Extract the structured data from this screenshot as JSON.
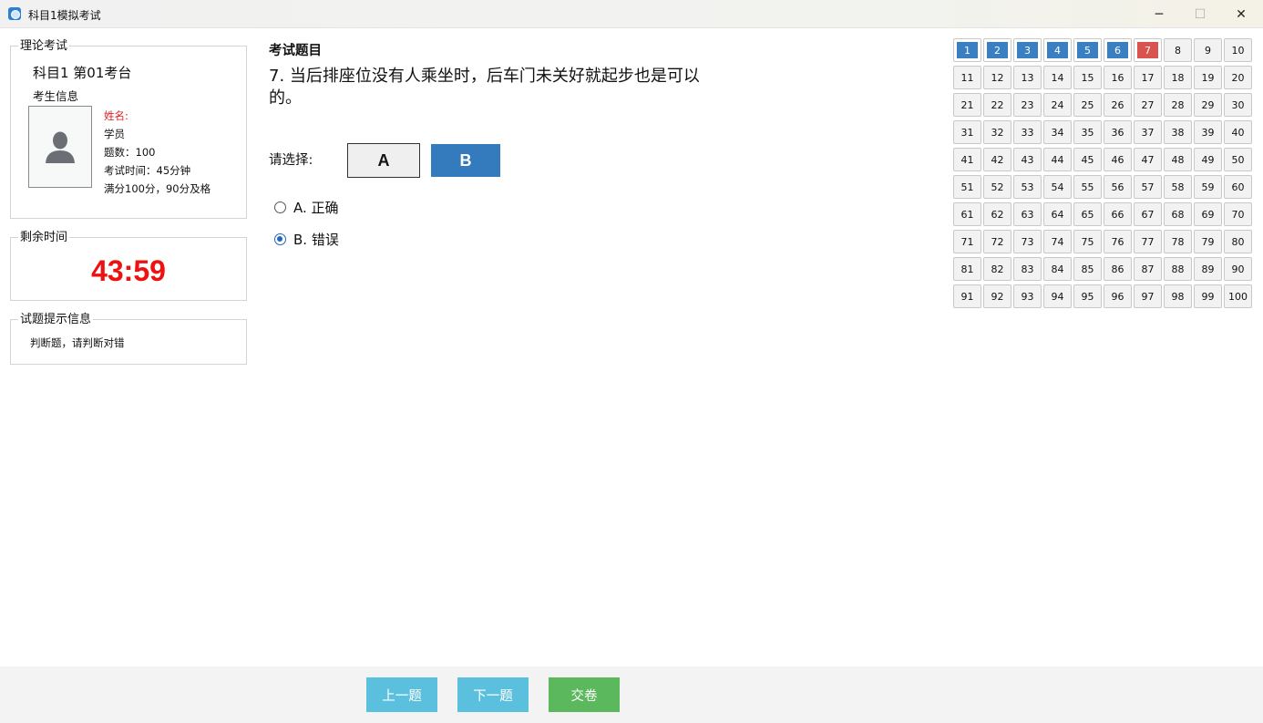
{
  "window": {
    "title": "科目1模拟考试",
    "minimize": "─",
    "maximize": "☐",
    "close": "✕"
  },
  "exam_group": {
    "legend": "理论考试",
    "heading": "科目1 第01考台",
    "info_heading": "考生信息",
    "name_label": "姓名:",
    "student": "学员",
    "question_count": "题数：100",
    "exam_time": "考试时间：45分钟",
    "score_rule": "满分100分，90分及格",
    "photo_icon": "person-silhouette-icon"
  },
  "timer_group": {
    "legend": "剩余时间",
    "value": "43:59"
  },
  "hint_group": {
    "legend": "试题提示信息",
    "text": "判断题，请判断对错"
  },
  "question": {
    "label": "考试题目",
    "text": "7. 当后排座位没有人乘坐时，后车门未关好就起步也是可以的。",
    "choose_label": "请选择:",
    "answer_buttons": [
      "A",
      "B"
    ],
    "options": [
      {
        "label": "A. 正确",
        "checked": false
      },
      {
        "label": "B. 错误",
        "checked": true
      }
    ]
  },
  "grid": {
    "total": 100,
    "answered": [
      1,
      2,
      3,
      4,
      5,
      6
    ],
    "current": 7,
    "colors": {
      "answered": "#3a7fc1",
      "current": "#d9534f"
    }
  },
  "footer": {
    "prev": "上一题",
    "next": "下一题",
    "submit": "交卷"
  }
}
